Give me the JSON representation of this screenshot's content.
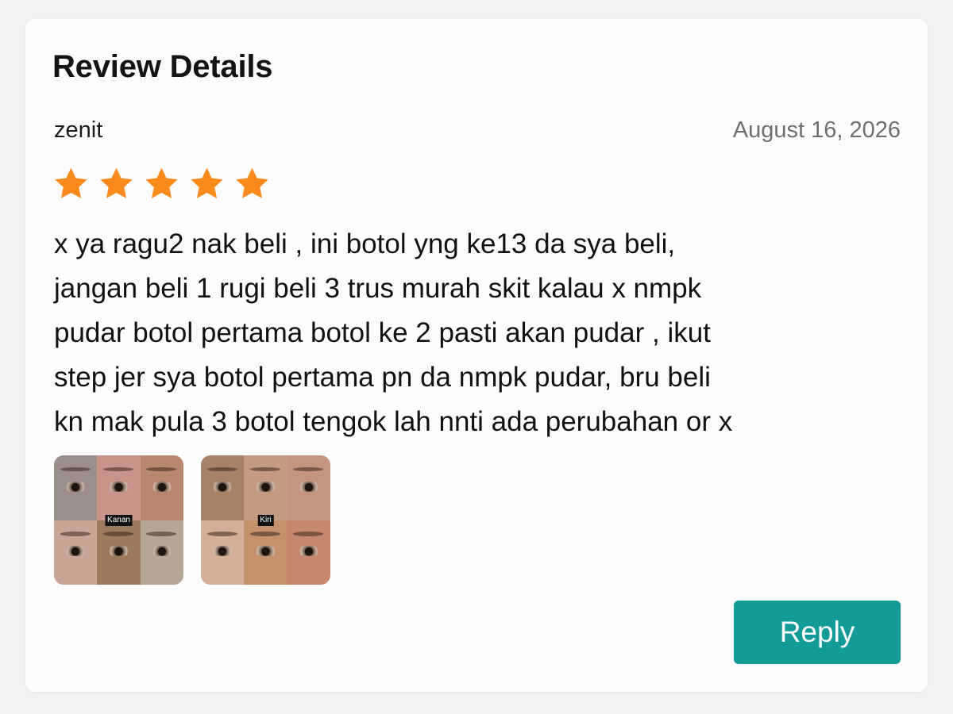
{
  "review": {
    "heading": "Review Details",
    "reviewer": "zenit",
    "date": "August 16, 2026",
    "rating": 5,
    "rating_max": 5,
    "star_color": "#F98A1B",
    "text": "x ya ragu2 nak beli , ini botol yng ke13 da sya beli,\njangan beli 1 rugi beli 3 trus murah skit kalau x nmpk\npudar botol pertama botol ke 2 pasti akan pudar , ikut\nstep jer sya botol pertama pn da nmpk pudar, bru beli\nkn mak pula 3 botol tengok lah nnti ada perubahan or x",
    "photos": [
      {
        "label": "Kanan"
      },
      {
        "label": "Kiri"
      }
    ]
  },
  "actions": {
    "reply_label": "Reply",
    "reply_color": "#139B98"
  }
}
